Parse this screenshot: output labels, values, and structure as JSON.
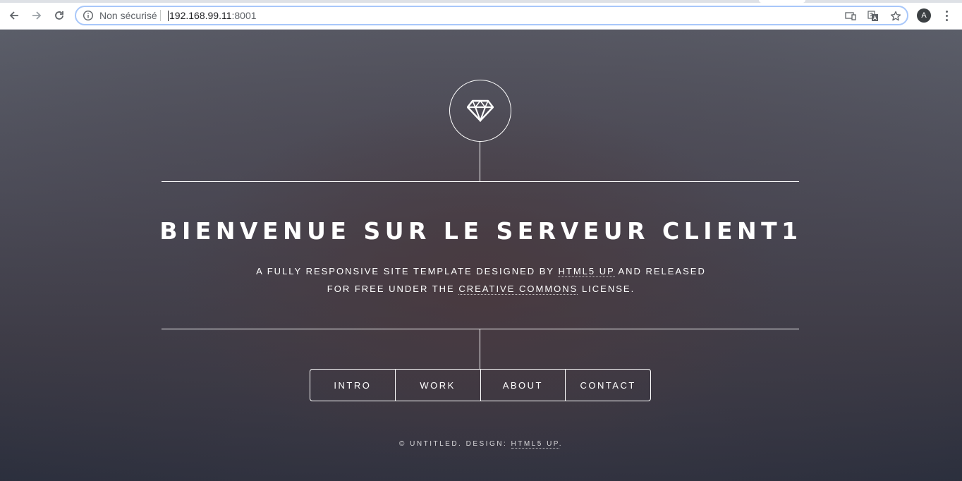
{
  "browser": {
    "security_label": "Non sécurisé",
    "url_host": "192.168.99.11",
    "url_port": ":8001",
    "profile_initial": "A",
    "icons": [
      "back-arrow-icon",
      "forward-arrow-icon",
      "reload-icon",
      "info-icon",
      "cast-icon",
      "translate-icon",
      "star-icon",
      "menu-dots-icon"
    ]
  },
  "page": {
    "logo_icon": "diamond-icon",
    "title": "BIENVENUE SUR LE SERVEUR CLIENT1",
    "subtitle": {
      "line1_before": "A FULLY RESPONSIVE SITE TEMPLATE DESIGNED BY ",
      "line1_link": "HTML5 UP",
      "line1_after": " AND RELEASED",
      "line2_before": "FOR FREE UNDER THE ",
      "line2_link": "CREATIVE COMMONS",
      "line2_after": " LICENSE."
    },
    "nav": [
      {
        "label": "INTRO"
      },
      {
        "label": "WORK"
      },
      {
        "label": "ABOUT"
      },
      {
        "label": "CONTACT"
      }
    ],
    "footer": {
      "before": "© UNTITLED. DESIGN: ",
      "link": "HTML5 UP",
      "after": "."
    }
  }
}
